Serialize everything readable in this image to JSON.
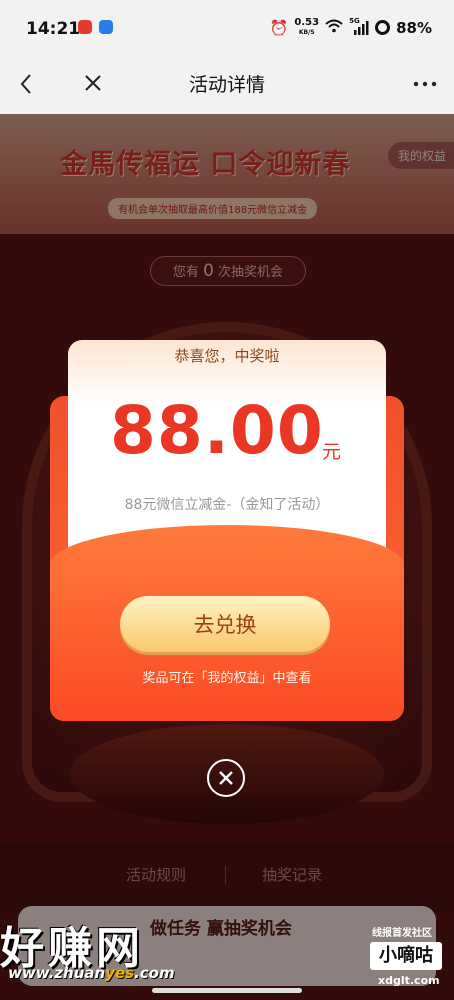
{
  "status_bar": {
    "time": "14:21",
    "net_speed_value": "0.53",
    "net_speed_unit": "KB/S",
    "network": "5G",
    "battery": "88%"
  },
  "navbar": {
    "title": "活动详情"
  },
  "banner": {
    "title": "金馬传福运 口令迎新春",
    "subtitle": "有机会单次抽取最高价值188元微信立减金",
    "my_rights": "我的权益"
  },
  "chances": {
    "prefix": "您有",
    "count": "0",
    "suffix": "次抽奖机会"
  },
  "bottom": {
    "rules": "活动规则",
    "records": "抽奖记录",
    "task": "做任务 赢抽奖机会"
  },
  "popup": {
    "congrats": "恭喜您，中奖啦",
    "amount": "88.00",
    "unit": "元",
    "description": "88元微信立减金-（金知了活动）",
    "redeem_label": "去兑换",
    "hint": "奖品可在「我的权益」中查看"
  },
  "watermark": {
    "main": "好赚网",
    "url_a": "www.zhuan",
    "url_b": "yes",
    "url_c": ".com",
    "secondary_top": "线报首发社区",
    "secondary_box": "小嘀咕",
    "secondary_url": "xdglt.com"
  }
}
